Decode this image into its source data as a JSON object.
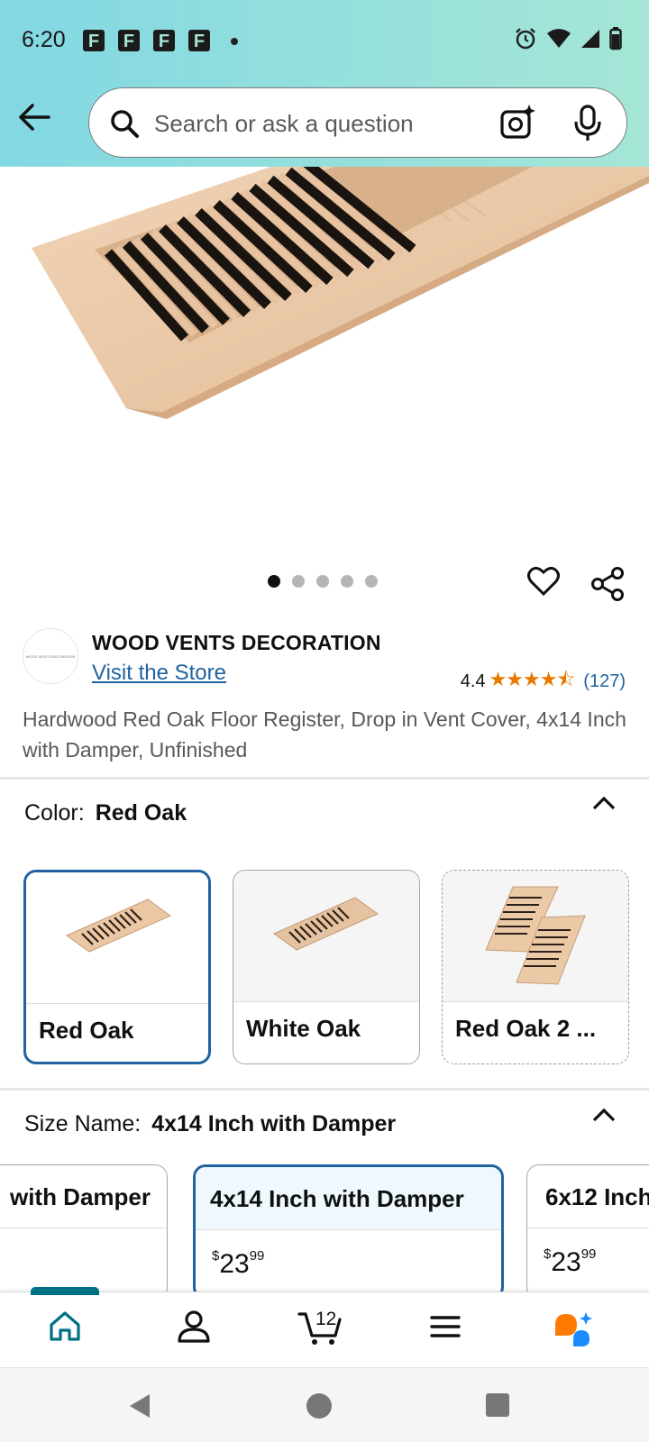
{
  "status_bar": {
    "time": "6:20",
    "notification_icons": [
      "F",
      "F",
      "F",
      "F"
    ]
  },
  "search": {
    "placeholder": "Search or ask a question"
  },
  "gallery": {
    "image_count": 5,
    "active_index": 0
  },
  "brand": {
    "logo_text": "WOOD VENTS DECORATION",
    "name": "WOOD VENTS DECORATION",
    "visit_store_label": "Visit the Store"
  },
  "rating": {
    "value": "4.4",
    "stars": "★★★★⯪",
    "count": "(127)"
  },
  "product": {
    "title": "Hardwood Red Oak Floor Register, Drop in Vent Cover, 4x14 Inch with Damper, Unfinished"
  },
  "color_section": {
    "label": "Color:",
    "selected": "Red Oak",
    "options": [
      {
        "label": "Red Oak"
      },
      {
        "label": "White Oak"
      },
      {
        "label": "Red Oak 2 ..."
      }
    ]
  },
  "size_section": {
    "label": "Size Name:",
    "selected": "4x14 Inch with Damper",
    "options": [
      {
        "name": "with Damper",
        "price_dollars": "",
        "price_cents": ""
      },
      {
        "name": "4x14 Inch with Damper",
        "price_symbol": "$",
        "price_dollars": "23",
        "price_cents": "99"
      },
      {
        "name": "6x12 Inch",
        "price_symbol": "$",
        "price_dollars": "23",
        "price_cents": "99"
      }
    ]
  },
  "bottom_nav": {
    "items": [
      "home-icon",
      "account-icon",
      "cart-icon",
      "menu-icon",
      "rufus-icon"
    ],
    "cart_count": "12",
    "active": "home"
  },
  "colors": {
    "accent_blue": "#2162a1",
    "teal": "#007185",
    "star_orange": "#e67a00",
    "header_gradient_start": "#82d8e3",
    "header_gradient_end": "#a5e6d6"
  }
}
